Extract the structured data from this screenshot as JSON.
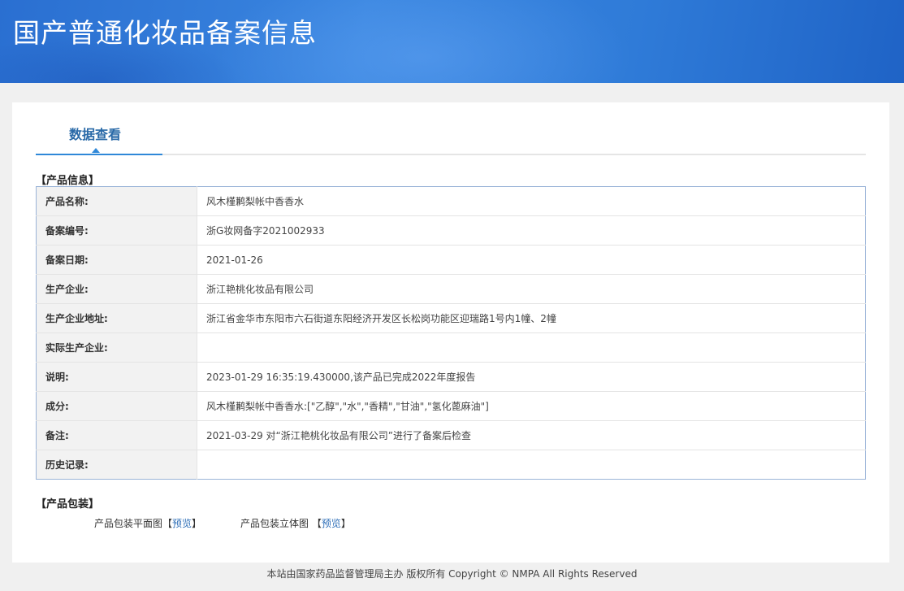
{
  "header": {
    "title": "国产普通化妆品备案信息"
  },
  "tabs": {
    "active_label": "数据查看"
  },
  "product_info": {
    "section_title": "【产品信息】",
    "rows": [
      {
        "label": "产品名称:",
        "value": "风木槿鹣梨帐中香香水"
      },
      {
        "label": "备案编号:",
        "value": "浙G妆网备字2021002933"
      },
      {
        "label": "备案日期:",
        "value": "2021-01-26"
      },
      {
        "label": "生产企业:",
        "value": "浙江艳桃化妆品有限公司"
      },
      {
        "label": "生产企业地址:",
        "value": "浙江省金华市东阳市六石街道东阳经济开发区长松岗功能区迎瑞路1号内1幢、2幢"
      },
      {
        "label": "实际生产企业:",
        "value": ""
      },
      {
        "label": "说明:",
        "value": "2023-01-29 16:35:19.430000,该产品已完成2022年度报告"
      },
      {
        "label": "成分:",
        "value": "风木槿鹣梨帐中香香水:[\"乙醇\",\"水\",\"香精\",\"甘油\",\"氢化蓖麻油\"]"
      },
      {
        "label": "备注:",
        "value": "2021-03-29 对“浙江艳桃化妆品有限公司”进行了备案后检查"
      },
      {
        "label": "历史记录:",
        "value": ""
      }
    ]
  },
  "packaging": {
    "section_title": "【产品包装】",
    "flat_label": "产品包装平面图",
    "stereo_label": "产品包装立体图",
    "bracket_open": "【",
    "bracket_close": "】",
    "preview_label": "预览"
  },
  "footer": {
    "text": "本站由国家药品监督管理局主办 版权所有 Copyright © NMPA All Rights Reserved"
  }
}
